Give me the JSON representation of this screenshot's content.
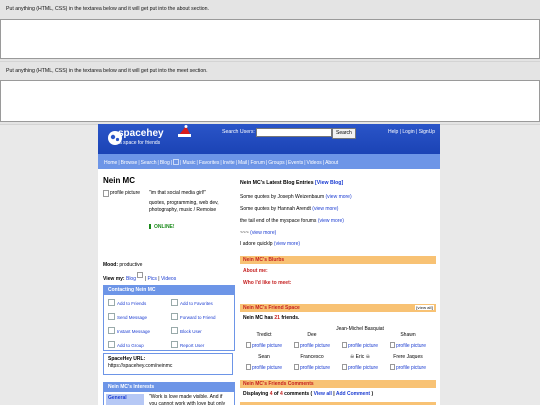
{
  "editors": {
    "about_hint": "Put anything (HTML, CSS) in the textarea below and it will get put into the about section.",
    "meet_hint": "Put anything (HTML, CSS) in the textarea below and it will get put into the meet section."
  },
  "header": {
    "logo_name": "spacehey",
    "logo_tagline": "a space for friends",
    "search_label": "Search Users:",
    "search_button": "Search",
    "links": [
      "Help",
      "Login",
      "SignUp"
    ]
  },
  "nav": [
    "Home",
    "Browse",
    "Search",
    "Blog",
    "Music",
    "Favorites",
    "Invite",
    "Mail",
    "Forum",
    "Groups",
    "Events",
    "Videos",
    "About"
  ],
  "profile": {
    "name": "Nein MC",
    "pic_alt": "profile picture",
    "quote_lines": [
      "\"im that social media girl!\"",
      "",
      "quotes, programming, web dev,",
      "photography, music / Remoise"
    ],
    "online": "ONLINE!",
    "mood_label": "Mood:",
    "mood_value": "productive",
    "view_my_label": "View my:",
    "view_my_links": [
      "Blog",
      "Pics",
      "Videos"
    ]
  },
  "contact": {
    "title": "Contacting Nein MC",
    "items": [
      "Add to Friends",
      "Add to Favorites",
      "Send Message",
      "Forward to Friend",
      "Instant Message",
      "Block User",
      "Add to Group",
      "Report User"
    ]
  },
  "url_box": {
    "label": "SpaceHey URL:",
    "value": "https://spacehey.com/neinmc"
  },
  "interests": {
    "title": "Nein MC's Interests",
    "category": "General",
    "text": "\"Work is love made visible. And if you cannot work with love but only"
  },
  "blog": {
    "heading": "Nein MC's Latest Blog Entries",
    "view_blog": "[View Blog]",
    "entries": [
      {
        "title": "Some quotes by Joseph Weizenbaum",
        "more": "(view more)"
      },
      {
        "title": "Some quotes by Hannah Arendt",
        "more": "(view more)"
      },
      {
        "title": "the tail end of the myspace forums",
        "more": "(view more)"
      },
      {
        "title": "~~~",
        "more": "(view more)"
      },
      {
        "title": "I adore quicklp",
        "more": "(view more)"
      }
    ]
  },
  "blurbs": {
    "title": "Nein MC's Blurbs",
    "about_me": "About me:",
    "who_meet": "Who I'd like to meet:"
  },
  "friends": {
    "title": "Nein MC's Friend Space",
    "view_all": "[view all]",
    "count_prefix": "Nein MC has",
    "count": "21",
    "count_suffix": "friends.",
    "pic_alt": "profile picture",
    "rows": [
      [
        "Tredict",
        "Dee",
        "Jean-Michel Basquiat",
        "Shawn"
      ],
      [
        "Sean",
        "Francesco",
        "☠ Eric ☠",
        "Frere Jaques"
      ]
    ]
  },
  "comments": {
    "title": "Nein MC's Friends Comments",
    "prefix": "Displaying",
    "shown": "4",
    "of": "of",
    "total": "4",
    "suffix": "comments",
    "view_all": "View all",
    "add": "Add Comment"
  }
}
